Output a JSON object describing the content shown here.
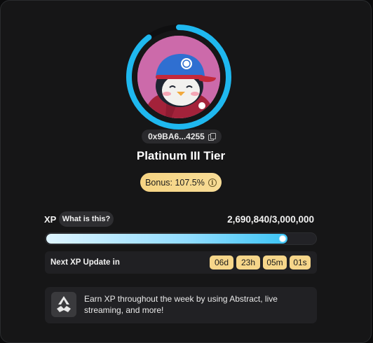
{
  "profile": {
    "wallet_address": "0x9BA6...4255",
    "tier": "Platinum III Tier",
    "bonus": "Bonus: 107.5%",
    "avatar_icon": "penguin-avatar",
    "ring_progress": 0.897
  },
  "xp": {
    "label": "XP",
    "help_label": "What is this?",
    "value_text": "2,690,840/3,000,000",
    "current": 2690840,
    "target": 3000000
  },
  "next_update": {
    "label": "Next XP Update in",
    "days": "06d",
    "hours": "23h",
    "minutes": "05m",
    "seconds": "01s"
  },
  "info": {
    "text": "Earn XP throughout the week by using Abstract, live streaming, and more!",
    "icon": "abstract-logo-icon"
  },
  "colors": {
    "accent": "#1fb8ef",
    "gold": "#f6d68a",
    "background": "#161617"
  }
}
